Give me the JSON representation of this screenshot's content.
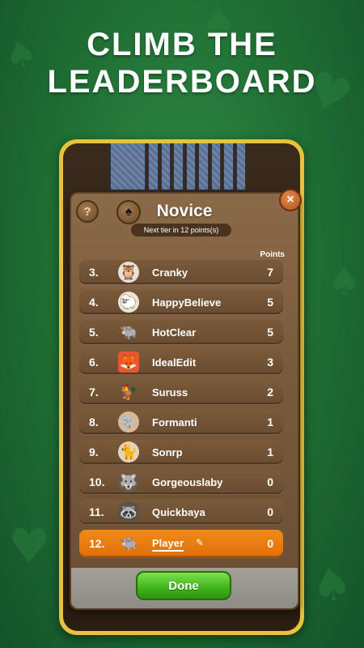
{
  "headline": {
    "line1": "CLIMB THE",
    "line2": "LEADERBOARD"
  },
  "panel": {
    "title": "Novice",
    "tier_text": "Next tier in 12 points(s)",
    "help_label": "?",
    "close_label": "×",
    "points_header": "Points",
    "done_label": "Done"
  },
  "rows": [
    {
      "rank": "3.",
      "avatar": "owl-icon",
      "glyph": "🦉",
      "bg": "#e9e2d4",
      "name": "Cranky",
      "points": "7"
    },
    {
      "rank": "4.",
      "avatar": "sheep-icon",
      "glyph": "🐑",
      "bg": "#efe5cf",
      "name": "HappyBelieve",
      "points": "5"
    },
    {
      "rank": "5.",
      "avatar": "buffalo-icon",
      "glyph": "🐃",
      "bg": "transparent",
      "name": "HotClear",
      "points": "5"
    },
    {
      "rank": "6.",
      "avatar": "fox-icon",
      "glyph": "🦊",
      "bg": "#e8562a",
      "name": "IdealEdit",
      "points": "3"
    },
    {
      "rank": "7.",
      "avatar": "rooster-icon",
      "glyph": "🐓",
      "bg": "transparent",
      "name": "Suruss",
      "points": "2"
    },
    {
      "rank": "8.",
      "avatar": "elephant-icon",
      "glyph": "🐘",
      "bg": "#d9b89a",
      "name": "Formanti",
      "points": "1"
    },
    {
      "rank": "9.",
      "avatar": "lynx-icon",
      "glyph": "🐈",
      "bg": "#e4d3bb",
      "name": "Sonrp",
      "points": "1"
    },
    {
      "rank": "10.",
      "avatar": "wolf-icon",
      "glyph": "🐺",
      "bg": "#6a5848",
      "name": "Gorgeouslaby",
      "points": "0"
    },
    {
      "rank": "11.",
      "avatar": "raccoon-icon",
      "glyph": "🦝",
      "bg": "#5a524a",
      "name": "Quickbaya",
      "points": "0"
    }
  ],
  "player_row": {
    "rank": "12.",
    "avatar": "buffalo-icon",
    "glyph": "🐃",
    "name": "Player",
    "points": "0"
  },
  "colors": {
    "background": "#1f6d33",
    "phone_frame": "#e8c23a",
    "player_highlight": "#f08a1a",
    "done_button": "#3fb31b"
  }
}
